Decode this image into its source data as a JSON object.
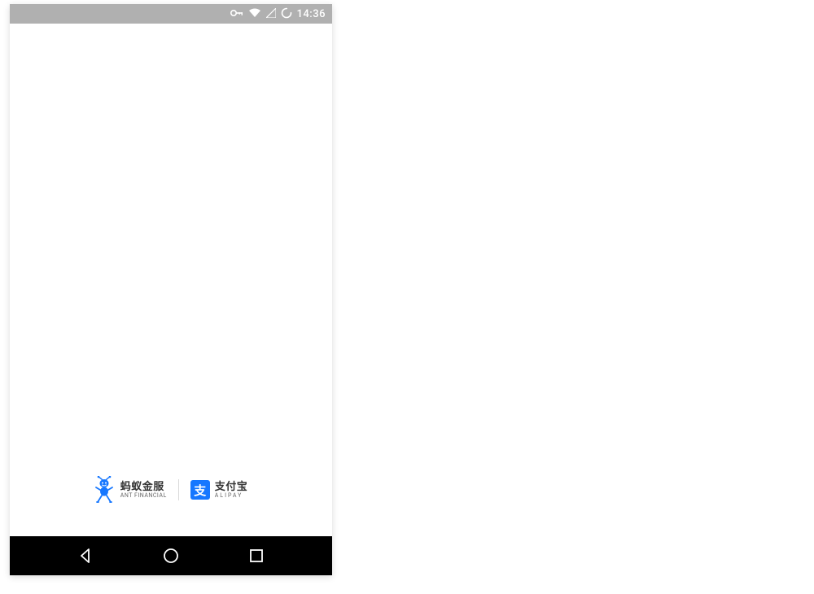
{
  "status_bar": {
    "time": "14:36",
    "icons": [
      "vpn-key",
      "wifi",
      "signal",
      "loading"
    ]
  },
  "splash": {
    "ant_financial": {
      "cn": "蚂蚁金服",
      "en": "ANT FINANCIAL"
    },
    "alipay": {
      "icon_text": "支",
      "cn": "支付宝",
      "en": "ALIPAY"
    }
  },
  "nav": {
    "back": "back",
    "home": "home",
    "recent": "recent"
  }
}
